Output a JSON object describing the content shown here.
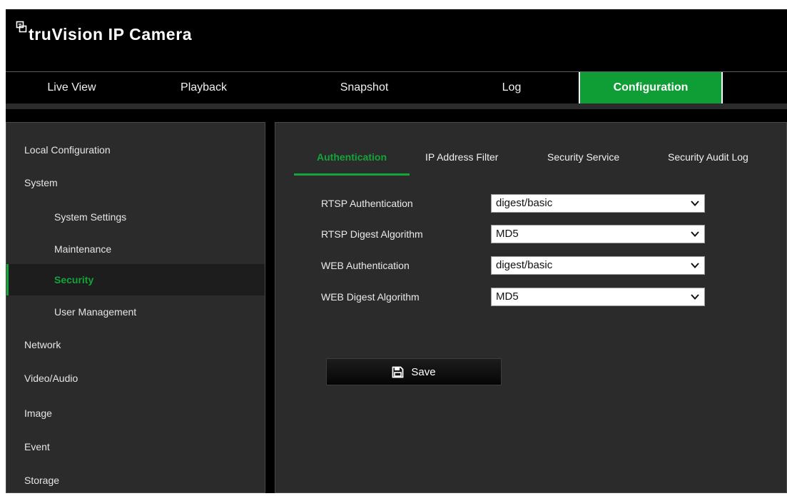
{
  "app": {
    "title": "truVision IP Camera"
  },
  "nav": {
    "items": [
      {
        "label": "Live View"
      },
      {
        "label": "Playback"
      },
      {
        "label": "Snapshot"
      },
      {
        "label": "Log"
      },
      {
        "label": "Configuration"
      }
    ],
    "active_color": "#0f9d35"
  },
  "sidebar": {
    "items": [
      {
        "label": "Local Configuration"
      },
      {
        "label": "System"
      },
      {
        "label": "System Settings"
      },
      {
        "label": "Maintenance"
      },
      {
        "label": "Security"
      },
      {
        "label": "User Management"
      },
      {
        "label": "Network"
      },
      {
        "label": "Video/Audio"
      },
      {
        "label": "Image"
      },
      {
        "label": "Event"
      },
      {
        "label": "Storage"
      }
    ],
    "active_color": "#13a43a"
  },
  "tabs": [
    {
      "label": "Authentication"
    },
    {
      "label": "IP Address Filter"
    },
    {
      "label": "Security Service"
    },
    {
      "label": "Security Audit Log"
    }
  ],
  "form": {
    "rows": [
      {
        "label": "RTSP Authentication",
        "value": "digest/basic"
      },
      {
        "label": "RTSP Digest Algorithm",
        "value": "MD5"
      },
      {
        "label": "WEB Authentication",
        "value": "digest/basic"
      },
      {
        "label": "WEB Digest Algorithm",
        "value": "MD5"
      }
    ],
    "save_label": "Save"
  }
}
